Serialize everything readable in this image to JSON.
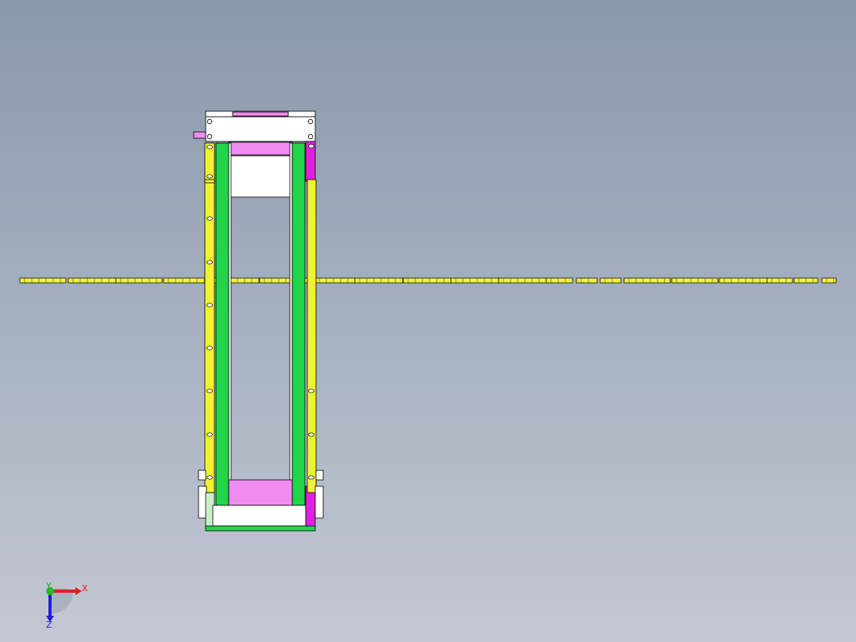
{
  "viewport": {
    "background_top": "#8998ab",
    "background_bottom": "#c3c8d3"
  },
  "model": {
    "frame_color": "#f2f234",
    "belt_color": "#22d44a",
    "roller_color": "#f08cf0",
    "side_plate_color": "#e020e0",
    "bracket_color": "#ffffff",
    "edge_color": "#000000"
  },
  "triad": {
    "x_label": "X",
    "y_label": "Y",
    "z_label": "Z",
    "x_color": "#e02020",
    "y_color": "#20c020",
    "z_color": "#2020d0",
    "icon": "coordinate-triad-icon"
  }
}
